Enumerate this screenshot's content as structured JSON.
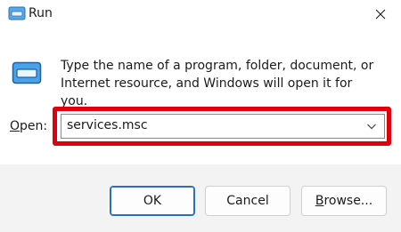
{
  "window": {
    "title": "Run"
  },
  "icons": {
    "app": "run-dialog-icon",
    "close": "close-icon",
    "dropdown": "chevron-down-icon"
  },
  "description": "Type the name of a program, folder, document, or Internet resource, and Windows will open it for you.",
  "open_field": {
    "label_accel": "O",
    "label_rest": "pen:",
    "value": "services.msc",
    "highlight_color": "#e0000d"
  },
  "buttons": {
    "ok": "OK",
    "cancel": "Cancel",
    "browse_accel": "B",
    "browse_rest": "rowse..."
  }
}
